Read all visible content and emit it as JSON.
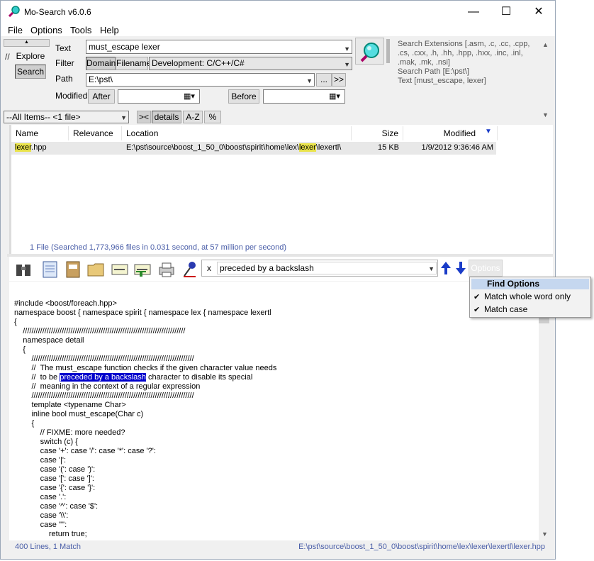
{
  "window": {
    "title": "Mo-Search v6.0.6",
    "minimize": "—",
    "maximize": "☐",
    "close": "✕"
  },
  "menu": [
    {
      "label": "File"
    },
    {
      "label": "Options"
    },
    {
      "label": "Tools"
    },
    {
      "label": "Help"
    }
  ],
  "nav": {
    "explore": "Explore",
    "search": "Search",
    "slashes": "//"
  },
  "form": {
    "text_label": "Text",
    "text_value": "must_escape lexer",
    "filter_label": "Filter",
    "filter_domain": "Domain",
    "filter_filename": "Filename",
    "filter_value": "Development: C/C++/C#",
    "path_label": "Path",
    "path_value": "E:\\pst\\",
    "path_browse": "...",
    "path_go": ">>",
    "modified_label": "Modified",
    "after": "After",
    "before": "Before"
  },
  "summary": {
    "line1": "Search Extensions [.asm, .c, .cc, .cpp,",
    "line2": ".cs, .cxx, .h, .hh, .hpp, .hxx, .inc, .inl,",
    "line3": ".mak, .mk, .nsi]",
    "line4": "Search Path [E:\\pst\\]",
    "line5": " Text [must_escape, lexer]"
  },
  "filterbar": {
    "items": "--All Items-- <1 file>",
    "toggle": "><",
    "details": "details",
    "az": "A-Z",
    "pct": "%"
  },
  "results": {
    "headers": {
      "name": "Name",
      "relevance": "Relevance",
      "location": "Location",
      "size": "Size",
      "modified": "Modified"
    },
    "row": {
      "name_hl": "lexer",
      "name_rest": ".hpp",
      "loc_a": "E:\\pst\\source\\boost_1_50_0\\boost\\spirit\\home\\lex\\",
      "loc_hl": "lexer",
      "loc_b": "\\lexertl\\",
      "size": "15 KB",
      "modified": "1/9/2012 9:36:46 AM"
    },
    "status": "1 File  (Searched 1,773,966 files in 0.031 second, at 57 million per second)"
  },
  "find": {
    "x": "x",
    "value": "preceded by a backslash",
    "options_btn": "Options"
  },
  "find_menu": {
    "header": "Find Options",
    "item1": "Match whole word only",
    "item2": "Match case",
    "check": "✔"
  },
  "code": {
    "l01": "#include <boost/foreach.hpp>",
    "l02": "",
    "l03": "namespace boost { namespace spirit { namespace lex { namespace lexertl",
    "l04": "{",
    "l05": "    ///////////////////////////////////////////////////////////////////////////",
    "l06": "    namespace detail",
    "l07": "    {",
    "l08": "        ///////////////////////////////////////////////////////////////////////////",
    "l09": "        //  The must_escape function checks if the given character value needs",
    "l10a": "        //  to be ",
    "l10hl": "preceded by a backslash",
    "l10b": " character to disable its special",
    "l11": "        //  meaning in the context of a regular expression",
    "l12": "        ///////////////////////////////////////////////////////////////////////////",
    "l13": "        template <typename Char>",
    "l14": "        inline bool must_escape(Char c)",
    "l15": "        {",
    "l16": "            // FIXME: more needed?",
    "l17": "            switch (c) {",
    "l18": "            case '+': case '/': case '*': case '?':",
    "l19": "            case '|':",
    "l20": "            case '(': case ')':",
    "l21": "            case '[': case ']':",
    "l22": "            case '{': case '}':",
    "l23": "            case '.':",
    "l24": "            case '^': case '$':",
    "l25": "            case '\\\\':",
    "l26": "            case '\"':",
    "l27": "                return true;"
  },
  "statusbar": {
    "left": "400 Lines, 1 Match",
    "right": "E:\\pst\\source\\boost_1_50_0\\boost\\spirit\\home\\lex\\lexer\\lexertl\\lexer.hpp"
  },
  "colors": {
    "accent": "#0000cc",
    "highlight": "#e9e34a",
    "status_text": "#4a5ea8"
  }
}
